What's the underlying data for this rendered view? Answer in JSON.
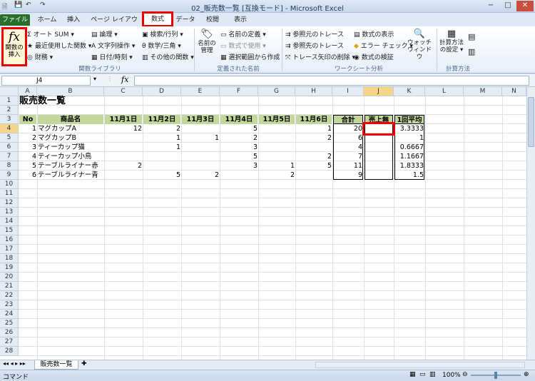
{
  "window": {
    "title": "02_販売数一覧 [互換モード] - Microsoft Excel",
    "min": "−",
    "max": "□",
    "close": "✕"
  },
  "tabs": [
    {
      "label": "ファイル"
    },
    {
      "label": "ホーム"
    },
    {
      "label": "挿入"
    },
    {
      "label": "ページ レイアウト"
    },
    {
      "label": "数式"
    },
    {
      "label": "データ"
    },
    {
      "label": "校閲"
    },
    {
      "label": "表示"
    }
  ],
  "ribbon": {
    "insert_function": "関数の挿入",
    "library": [
      "オート SUM ▾",
      "最近使用した関数 ▾",
      "財務 ▾",
      "論理 ▾",
      "文字列操作 ▾",
      "日付/時刻 ▾",
      "検索/行列 ▾",
      "数学/三角 ▾",
      "その他の関数 ▾"
    ],
    "name_manager": "名前の管理",
    "names": [
      "名前の定義 ▾",
      "数式で使用 ▾",
      "選択範囲から作成"
    ],
    "audit": [
      "参照元のトレース",
      "参照先のトレース",
      "トレース矢印の削除 ▾",
      "数式の表示",
      "エラー チェック ▾",
      "数式の検証"
    ],
    "watch": "ウォッチ ウィンドウ",
    "calc_options": "計算方法の設定 ▾",
    "groups": [
      "関数ライブラリ",
      "定義された名前",
      "ワークシート分析",
      "計算方法"
    ]
  },
  "formula_bar": {
    "name_box": "J4",
    "fx": "fx",
    "value": ""
  },
  "columns": [
    "A",
    "B",
    "C",
    "D",
    "E",
    "F",
    "G",
    "H",
    "I",
    "J",
    "K",
    "L",
    "M",
    "N"
  ],
  "selected_cell": "J4",
  "sheet": {
    "title": "販売数一覧",
    "headers": [
      "No",
      "商品名",
      "11月1日",
      "11月2日",
      "11月3日",
      "11月4日",
      "11月5日",
      "11月6日",
      "合計",
      "売上無",
      "1回平均"
    ],
    "rows": [
      [
        "1",
        "マグカップA",
        "12",
        "2",
        "",
        "5",
        "",
        "1",
        "20",
        "",
        "3.3333"
      ],
      [
        "2",
        "マグカップB",
        "",
        "1",
        "1",
        "2",
        "",
        "2",
        "6",
        "",
        "1"
      ],
      [
        "3",
        "ティーカップ猫",
        "",
        "1",
        "",
        "3",
        "",
        "",
        "4",
        "",
        "0.6667"
      ],
      [
        "4",
        "ティーカップ小鳥",
        "",
        "",
        "",
        "5",
        "",
        "2",
        "7",
        "",
        "1.1667"
      ],
      [
        "5",
        "テーブルライナー赤",
        "2",
        "",
        "",
        "3",
        "1",
        "5",
        "11",
        "",
        "1.8333"
      ],
      [
        "6",
        "テーブルライナー青",
        "",
        "5",
        "2",
        "",
        "2",
        "",
        "9",
        "",
        "1.5"
      ]
    ]
  },
  "sheet_tab": "販売数一覧",
  "status": {
    "mode": "コマンド",
    "zoom": "100%"
  }
}
